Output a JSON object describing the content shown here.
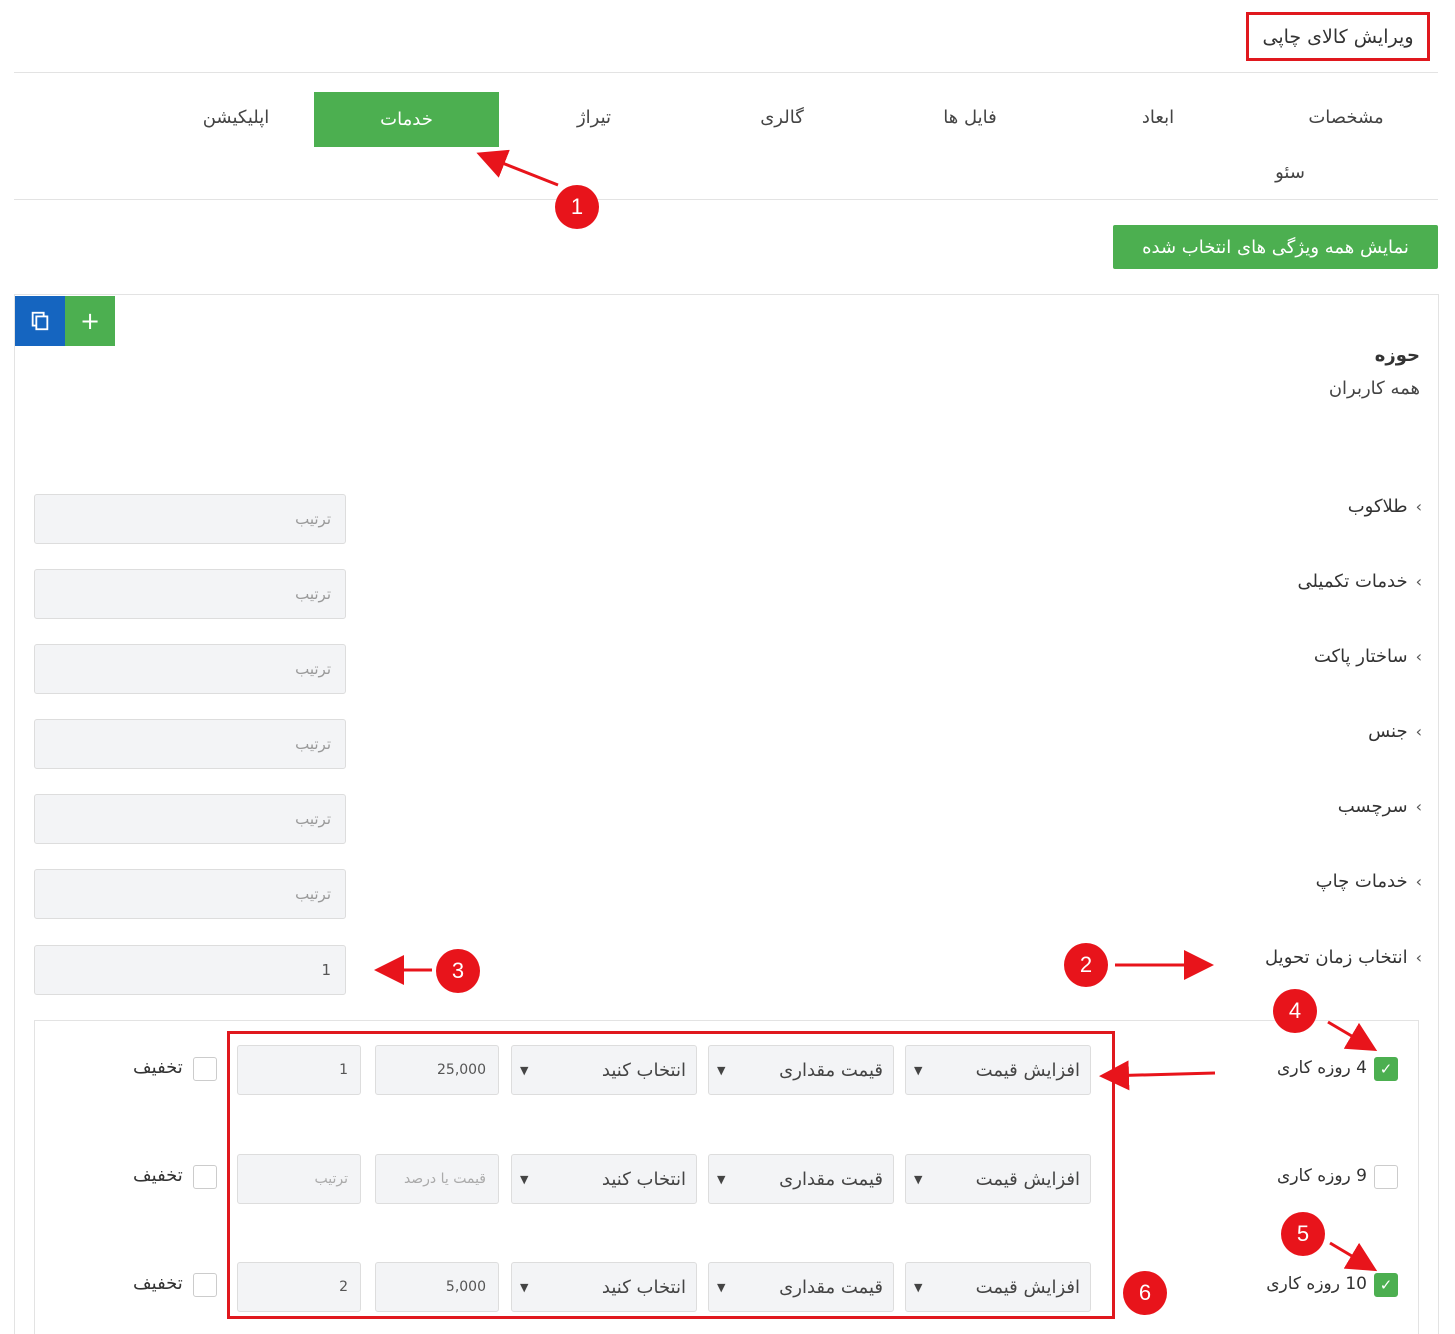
{
  "header": {
    "title": "ویرایش کالای چاپی"
  },
  "tabs": [
    {
      "label": "مشخصات"
    },
    {
      "label": "ابعاد"
    },
    {
      "label": "فایل ها"
    },
    {
      "label": "گالری"
    },
    {
      "label": "تیراژ"
    },
    {
      "label": "خدمات"
    },
    {
      "label": "اپلیکیشن"
    },
    {
      "label": "سئو"
    }
  ],
  "show_all_label": "نمایش همه ویژگی های انتخاب شده",
  "toolbar": {
    "add_label": "+",
    "copy_icon": "copy-icon"
  },
  "scope": {
    "title": "حوزه",
    "value": "همه کاربران"
  },
  "groups": [
    {
      "label": "طلاکوب",
      "order_placeholder": "ترتیب"
    },
    {
      "label": "خدمات تکمیلی",
      "order_placeholder": "ترتیب"
    },
    {
      "label": "ساختار پاکت",
      "order_placeholder": "ترتیب"
    },
    {
      "label": "جنس",
      "order_placeholder": "ترتیب"
    },
    {
      "label": "سرچسب",
      "order_placeholder": "ترتیب"
    },
    {
      "label": "خدمات چاپ",
      "order_placeholder": "ترتیب"
    },
    {
      "label": "انتخاب زمان تحویل",
      "order_value": "1"
    }
  ],
  "options": [
    {
      "checked": true,
      "label": "4 روزه کاری",
      "type": "افزایش قیمت",
      "price_type": "قیمت مقداری",
      "select": "انتخاب کنید",
      "price": "25,000",
      "order": "1",
      "discount": "تخفیف"
    },
    {
      "checked": false,
      "label": "9 روزه کاری",
      "type": "افزایش قیمت",
      "price_type": "قیمت مقداری",
      "select": "انتخاب کنید",
      "price_placeholder": "قیمت یا درصد",
      "order_placeholder": "ترتیب",
      "discount": "تخفیف"
    },
    {
      "checked": true,
      "label": "10 روزه کاری",
      "type": "افزایش قیمت",
      "price_type": "قیمت مقداری",
      "select": "انتخاب کنید",
      "price": "5,000",
      "order": "2",
      "discount": "تخفیف"
    }
  ],
  "annotations": [
    "1",
    "2",
    "3",
    "4",
    "5",
    "6"
  ],
  "colors": {
    "accent": "#4caf50",
    "copy_button": "#1565c0",
    "annotation": "#e8141b"
  }
}
